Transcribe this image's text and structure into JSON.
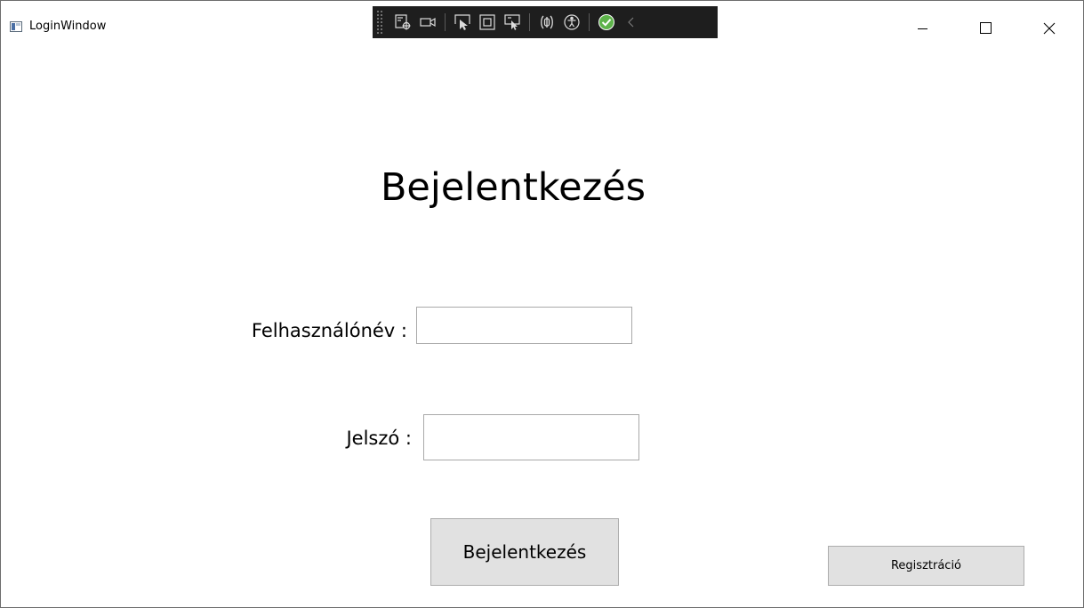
{
  "window": {
    "title": "LoginWindow",
    "caption_buttons": {
      "minimize_icon": "minimize-icon",
      "maximize_icon": "maximize-icon",
      "close_icon": "close-icon"
    }
  },
  "debug_toolbar": {
    "icons": [
      "select-element-icon",
      "live-preview-icon",
      "pointer-select-icon",
      "display-layout-adorners-icon",
      "track-focus-icon",
      "binding-failures-icon",
      "accessibility-icon",
      "checkmark-icon",
      "collapse-chevron-icon"
    ],
    "colors": {
      "background": "#1e1e1e",
      "icon": "#dcdcdc",
      "check": "#5db34a"
    }
  },
  "login_form": {
    "heading": "Bejelentkezés",
    "username_label": "Felhasználónév :",
    "username_value": "",
    "password_label": "Jelszó :",
    "password_value": "",
    "login_button": "Bejelentkezés",
    "register_button": "Regisztráció"
  },
  "colors": {
    "button_face": "#e1e1e1",
    "button_border": "#adadad",
    "input_border": "#a9a9a9",
    "window_border": "#6d6d6d"
  }
}
